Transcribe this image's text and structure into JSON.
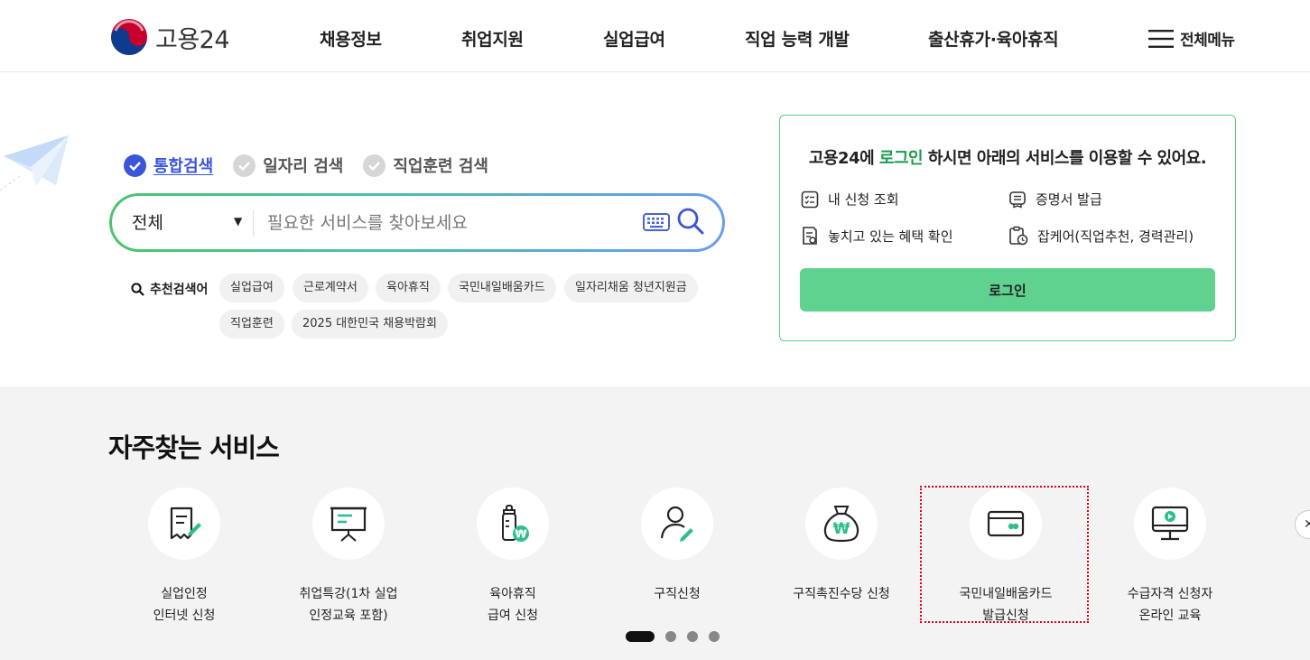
{
  "header": {
    "logo_text": "고용24",
    "nav": [
      {
        "label": "채용정보"
      },
      {
        "label": "취업지원"
      },
      {
        "label": "실업급여"
      },
      {
        "label": "직업 능력 개발"
      },
      {
        "label": "출산휴가·육아휴직"
      }
    ],
    "all_menu_label": "전체메뉴"
  },
  "search": {
    "tabs": [
      {
        "label": "통합검색",
        "active": true
      },
      {
        "label": "일자리 검색",
        "active": false
      },
      {
        "label": "직업훈련 검색",
        "active": false
      }
    ],
    "scope_value": "전체",
    "placeholder": "필요한 서비스를 찾아보세요",
    "recommended_label": "추천검색어",
    "recommended": [
      "실업급여",
      "근로계약서",
      "육아휴직",
      "국민내일배움카드",
      "일자리채움 청년지원금",
      "직업훈련",
      "2025 대한민국 채용박람회"
    ]
  },
  "login_box": {
    "msg_prefix": "고용24에 ",
    "msg_highlight": "로그인",
    "msg_suffix": " 하시면 아래의 서비스를 이용할 수 있어요.",
    "services": [
      {
        "label": "내 신청 조회",
        "icon": "list-check-icon"
      },
      {
        "label": "증명서 발급",
        "icon": "certificate-icon"
      },
      {
        "label": "놓치고 있는 혜택 확인",
        "icon": "benefit-doc-icon"
      },
      {
        "label": "잡케어(직업추천, 경력관리)",
        "icon": "clipboard-clock-icon"
      }
    ],
    "button_label": "로그인"
  },
  "frequent": {
    "title": "자주찾는 서비스",
    "items": [
      {
        "label": "실업인정\n인터넷 신청",
        "icon": "document-pen-icon"
      },
      {
        "label": "취업특강(1차 실업\n인정교육 포함)",
        "icon": "presentation-board-icon"
      },
      {
        "label": "육아휴직\n급여 신청",
        "icon": "baby-bottle-won-icon"
      },
      {
        "label": "구직신청",
        "icon": "person-pen-icon"
      },
      {
        "label": "구직촉진수당 신청",
        "icon": "money-bag-won-icon"
      },
      {
        "label": "국민내일배움카드\n발급신청",
        "icon": "card-icon"
      },
      {
        "label": "수급자격 신청자\n온라인 교육",
        "icon": "monitor-play-icon"
      }
    ],
    "pagination_count": 4,
    "active_page": 1
  },
  "colors": {
    "accent_green": "#5fd28f",
    "highlight_text": "#1f9a4f",
    "active_tab": "#3b55d9",
    "icon_accent": "#2fbf8a"
  }
}
